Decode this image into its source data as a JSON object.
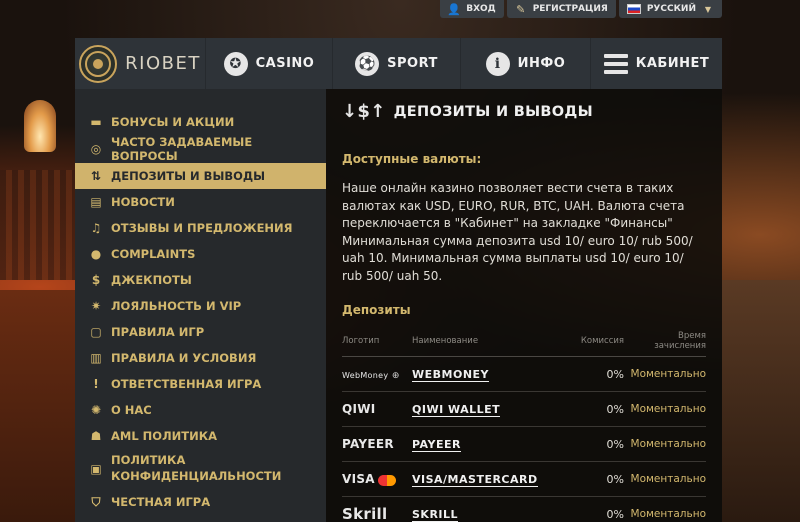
{
  "topbar": {
    "login": "ВХОД",
    "register": "РЕГИСТРАЦИЯ",
    "language": "РУССКИЙ"
  },
  "header": {
    "logo_text": "RIOBET",
    "nav": [
      {
        "label": "CASINO"
      },
      {
        "label": "SPORT"
      },
      {
        "label": "ИНФО"
      },
      {
        "label": "КАБИНЕТ"
      }
    ]
  },
  "sidebar": {
    "items": [
      {
        "label": "БОНУСЫ И АКЦИИ",
        "icon": "card-icon"
      },
      {
        "label": "ЧАСТО ЗАДАВАЕМЫЕ ВОПРОСЫ",
        "icon": "lifebuoy-icon"
      },
      {
        "label": "ДЕПОЗИТЫ И ВЫВОДЫ",
        "icon": "deposit-arrows-icon"
      },
      {
        "label": "НОВОСТИ",
        "icon": "news-icon"
      },
      {
        "label": "ОТЗЫВЫ И ПРЕДЛОЖЕНИЯ",
        "icon": "bell-icon"
      },
      {
        "label": "COMPLAINTS",
        "icon": "chat-bubble-icon"
      },
      {
        "label": "ДЖЕКПОТЫ",
        "icon": "money-bag-icon"
      },
      {
        "label": "ЛОЯЛЬНОСТЬ И VIP",
        "icon": "medal-icon"
      },
      {
        "label": "ПРАВИЛА ИГР",
        "icon": "book-icon"
      },
      {
        "label": "ПРАВИЛА И УСЛОВИЯ",
        "icon": "open-book-icon"
      },
      {
        "label": "ОТВЕТСТВЕННАЯ ИГРА",
        "icon": "exclamation-icon"
      },
      {
        "label": "О НАС",
        "icon": "badge-icon"
      },
      {
        "label": "AML ПОЛИТИКА",
        "icon": "spy-icon"
      },
      {
        "label": "ПОЛИТИКА КОНФИДЕНЦИАЛЬНОСТИ",
        "icon": "lock-icon"
      },
      {
        "label": "ЧЕСТНАЯ ИГРА",
        "icon": "shield-icon"
      }
    ]
  },
  "main": {
    "title": "ДЕПОЗИТЫ И ВЫВОДЫ",
    "currencies_heading": "Доступные валюты:",
    "currencies_text_1": "Наше онлайн казино позволяет вести счета в таких валютах как USD, EURO, RUR, BTC, UAH. Валюта счета переключается в \"Кабинет\" на закладке \"Финансы\"",
    "currencies_text_2": "Минимальная сумма депозита usd 10/ euro 10/ rub 500/ uah 10. Минимальная сумма выплаты usd 10/ euro 10/ rub 500/ uah 50.",
    "deposits_heading": "Депозиты",
    "table": {
      "headers": [
        "Логотип",
        "Наименование",
        "Комиссия",
        "Время зачисления"
      ],
      "rows": [
        {
          "logo": "WebMoney",
          "name": "WEBMONEY",
          "fee": "0%",
          "time": "Моментально"
        },
        {
          "logo": "QIWI",
          "name": "QIWI WALLET",
          "fee": "0%",
          "time": "Моментально"
        },
        {
          "logo": "PAYEER",
          "name": "PAYEER",
          "fee": "0%",
          "time": "Моментально"
        },
        {
          "logo": "VISA",
          "name": "VISA/MASTERCARD",
          "fee": "0%",
          "time": "Моментально"
        },
        {
          "logo": "Skrill",
          "name": "SKRILL",
          "fee": "0%",
          "time": "Моментально"
        }
      ]
    }
  }
}
